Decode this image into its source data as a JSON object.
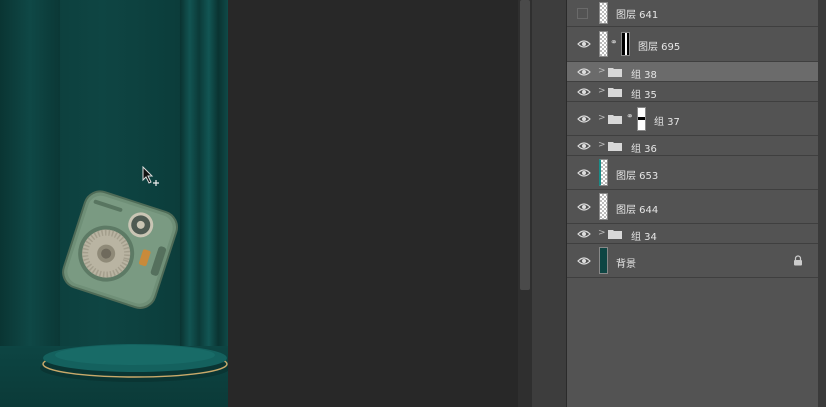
{
  "layers_panel": {
    "layers": [
      {
        "name": "图层 641",
        "type": "image",
        "visible": false
      },
      {
        "name": "图层 695",
        "type": "image-with-mask",
        "visible": true
      },
      {
        "name": "组 38",
        "type": "group",
        "visible": true,
        "selected": true
      },
      {
        "name": "组 35",
        "type": "group",
        "visible": true
      },
      {
        "name": "组 37",
        "type": "group-with-mask",
        "visible": true
      },
      {
        "name": "组 36",
        "type": "group",
        "visible": true
      },
      {
        "name": "图层 653",
        "type": "image",
        "visible": true
      },
      {
        "name": "图层 644",
        "type": "image",
        "visible": true
      },
      {
        "name": "组 34",
        "type": "group",
        "visible": true
      },
      {
        "name": "背景",
        "type": "background",
        "visible": true,
        "locked": true
      }
    ]
  },
  "colors": {
    "canvas_bg": "#0e4543",
    "panel_bg": "#535353",
    "selected_row": "#6b6b6b",
    "workspace_bg": "#282828",
    "speaker_body": "#6f8f77",
    "gold_accent": "#c9a96a"
  },
  "icons": {
    "visibility": "eye-icon",
    "group": "folder-icon",
    "expand": "chevron-right-icon",
    "link": "chain-link-icon",
    "lock": "lock-icon"
  }
}
